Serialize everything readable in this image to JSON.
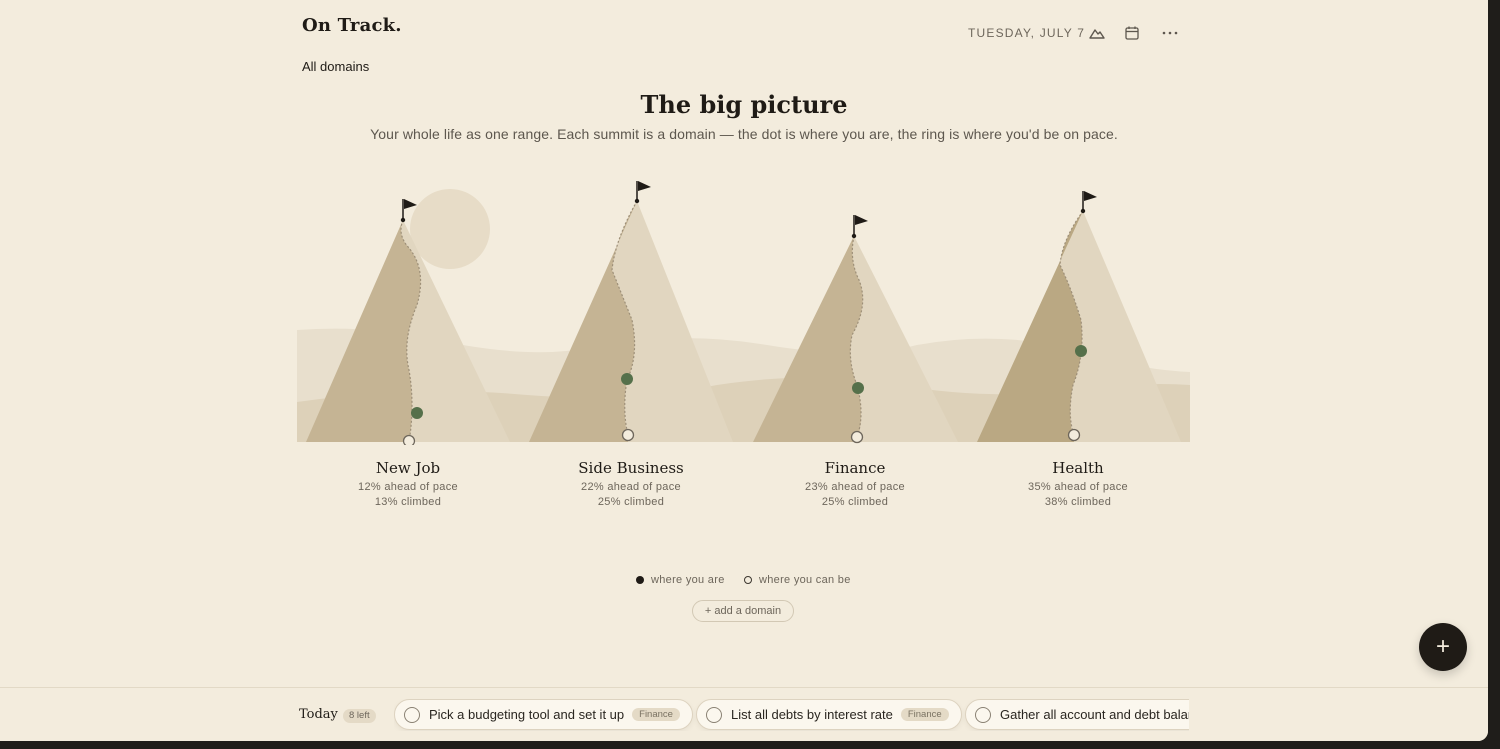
{
  "app": {
    "name": "On Track.",
    "scope": "All domains",
    "date": "TUESDAY, JULY 7"
  },
  "header": {
    "icons": [
      "mountain-icon",
      "calendar-icon",
      "more-icon"
    ]
  },
  "hero": {
    "title": "The big picture",
    "subtitle": "Your whole life as one range. Each summit is a domain — the dot is where you are, the ring is where you'd be on pace."
  },
  "domains": [
    {
      "name": "New Job",
      "pace": "12% ahead of pace",
      "climbed": "13% climbed",
      "climbed_pct": 13
    },
    {
      "name": "Side Business",
      "pace": "22% ahead of pace",
      "climbed": "25% climbed",
      "climbed_pct": 25
    },
    {
      "name": "Finance",
      "pace": "23% ahead of pace",
      "climbed": "25% climbed",
      "climbed_pct": 25
    },
    {
      "name": "Health",
      "pace": "35% ahead of pace",
      "climbed": "38% climbed",
      "climbed_pct": 38
    }
  ],
  "legend": {
    "current": "where you are",
    "target": "where you can be"
  },
  "add_domain_label": "+ add a domain",
  "fab_label": "+",
  "today": {
    "label": "Today",
    "left": "8 left",
    "tasks": [
      {
        "text": "Pick a budgeting tool and set it up",
        "tag": "Finance"
      },
      {
        "text": "List all debts by interest rate",
        "tag": "Finance"
      },
      {
        "text": "Gather all account and debt balan",
        "tag": ""
      }
    ]
  },
  "colors": {
    "background": "#f3ecdd",
    "mountain_shadow": "#c4b293",
    "mountain_light": "#e0d5bf",
    "progress_dot": "#55704a",
    "ink": "#1f1b16"
  }
}
